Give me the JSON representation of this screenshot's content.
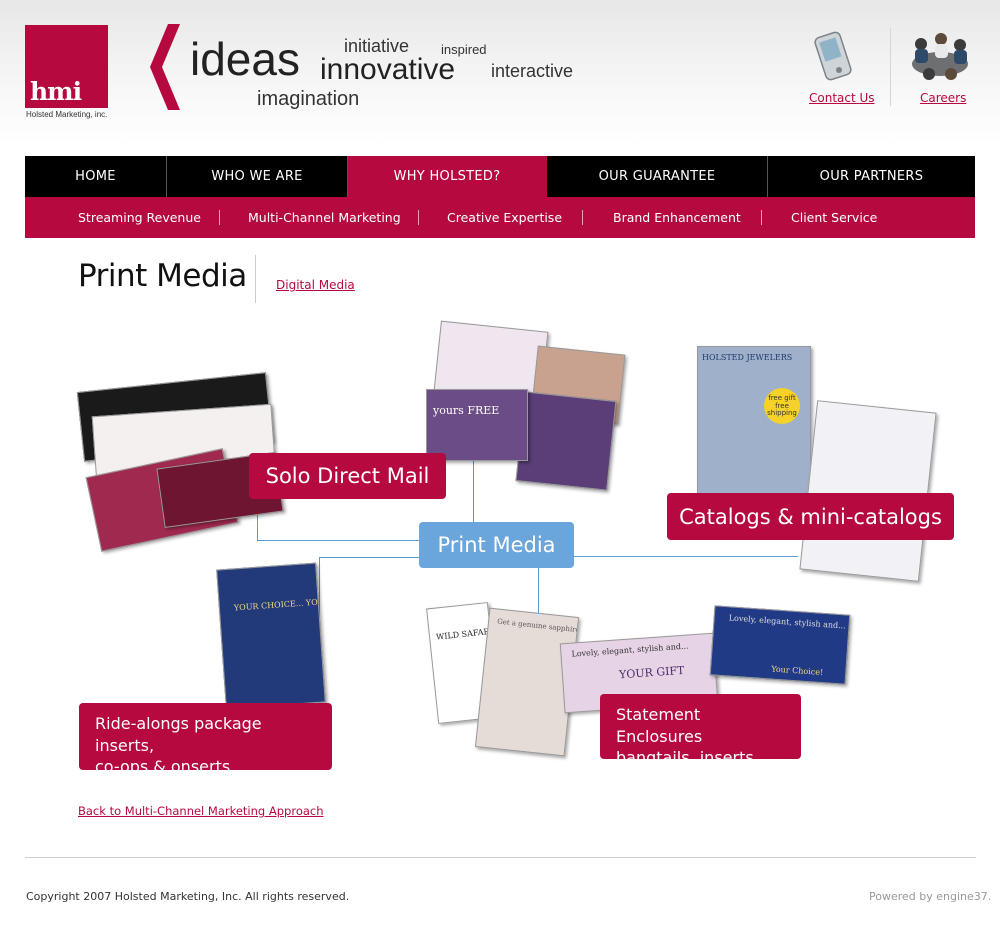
{
  "brand": {
    "logo_text": "hmi",
    "caption": "Holsted Marketing, inc.",
    "accent_color": "#b5093f",
    "node_color": "#6aa6dc"
  },
  "tagline": {
    "ideas": "ideas",
    "initiative": "initiative",
    "inspired": "inspired",
    "innovative": "innovative",
    "interactive": "interactive",
    "imagination": "imagination"
  },
  "header_links": {
    "contact": "Contact Us",
    "careers": "Careers",
    "contact_icon": "pda-icon",
    "careers_icon": "people-meeting-icon"
  },
  "nav": {
    "items": [
      "HOME",
      "WHO WE ARE",
      "WHY HOLSTED?",
      "OUR GUARANTEE",
      "OUR PARTNERS"
    ],
    "active": "WHY HOLSTED?"
  },
  "subnav": {
    "items": [
      "Streaming Revenue",
      "Multi-Channel Marketing",
      "Creative Expertise",
      "Brand Enhancement",
      "Client Service"
    ]
  },
  "page": {
    "title": "Print Media",
    "alt_link": "Digital Media"
  },
  "diagram": {
    "center": "Print Media",
    "solo": "Solo Direct Mail",
    "catalogs": "Catalogs & mini-catalogs",
    "ridealongs": "Ride-alongs package inserts,\nco-ops & onserts",
    "statements": "Statement Enclosures\nbangtails, inserts"
  },
  "thumbs": {
    "yours_free": "yours FREE",
    "holsted_jewelers": "HOLSTED JEWELERS",
    "your_choice": "YOUR CHOICE... YOURS FREE!",
    "wild_safari": "WILD SAFARI",
    "your_gift": "YOUR GIFT",
    "lovely": "Lovely, elegant, stylish and...",
    "your_choice_short": "Your Choice!",
    "genuine": "Get a genuine sapphire bracelet",
    "free_shipping": "free gift free shipping"
  },
  "back_link": "Back to Multi-Channel Marketing Approach",
  "footer": {
    "copyright": "Copyright 2007 Holsted Marketing, Inc. All rights reserved.",
    "powered": "Powered by engine37."
  }
}
